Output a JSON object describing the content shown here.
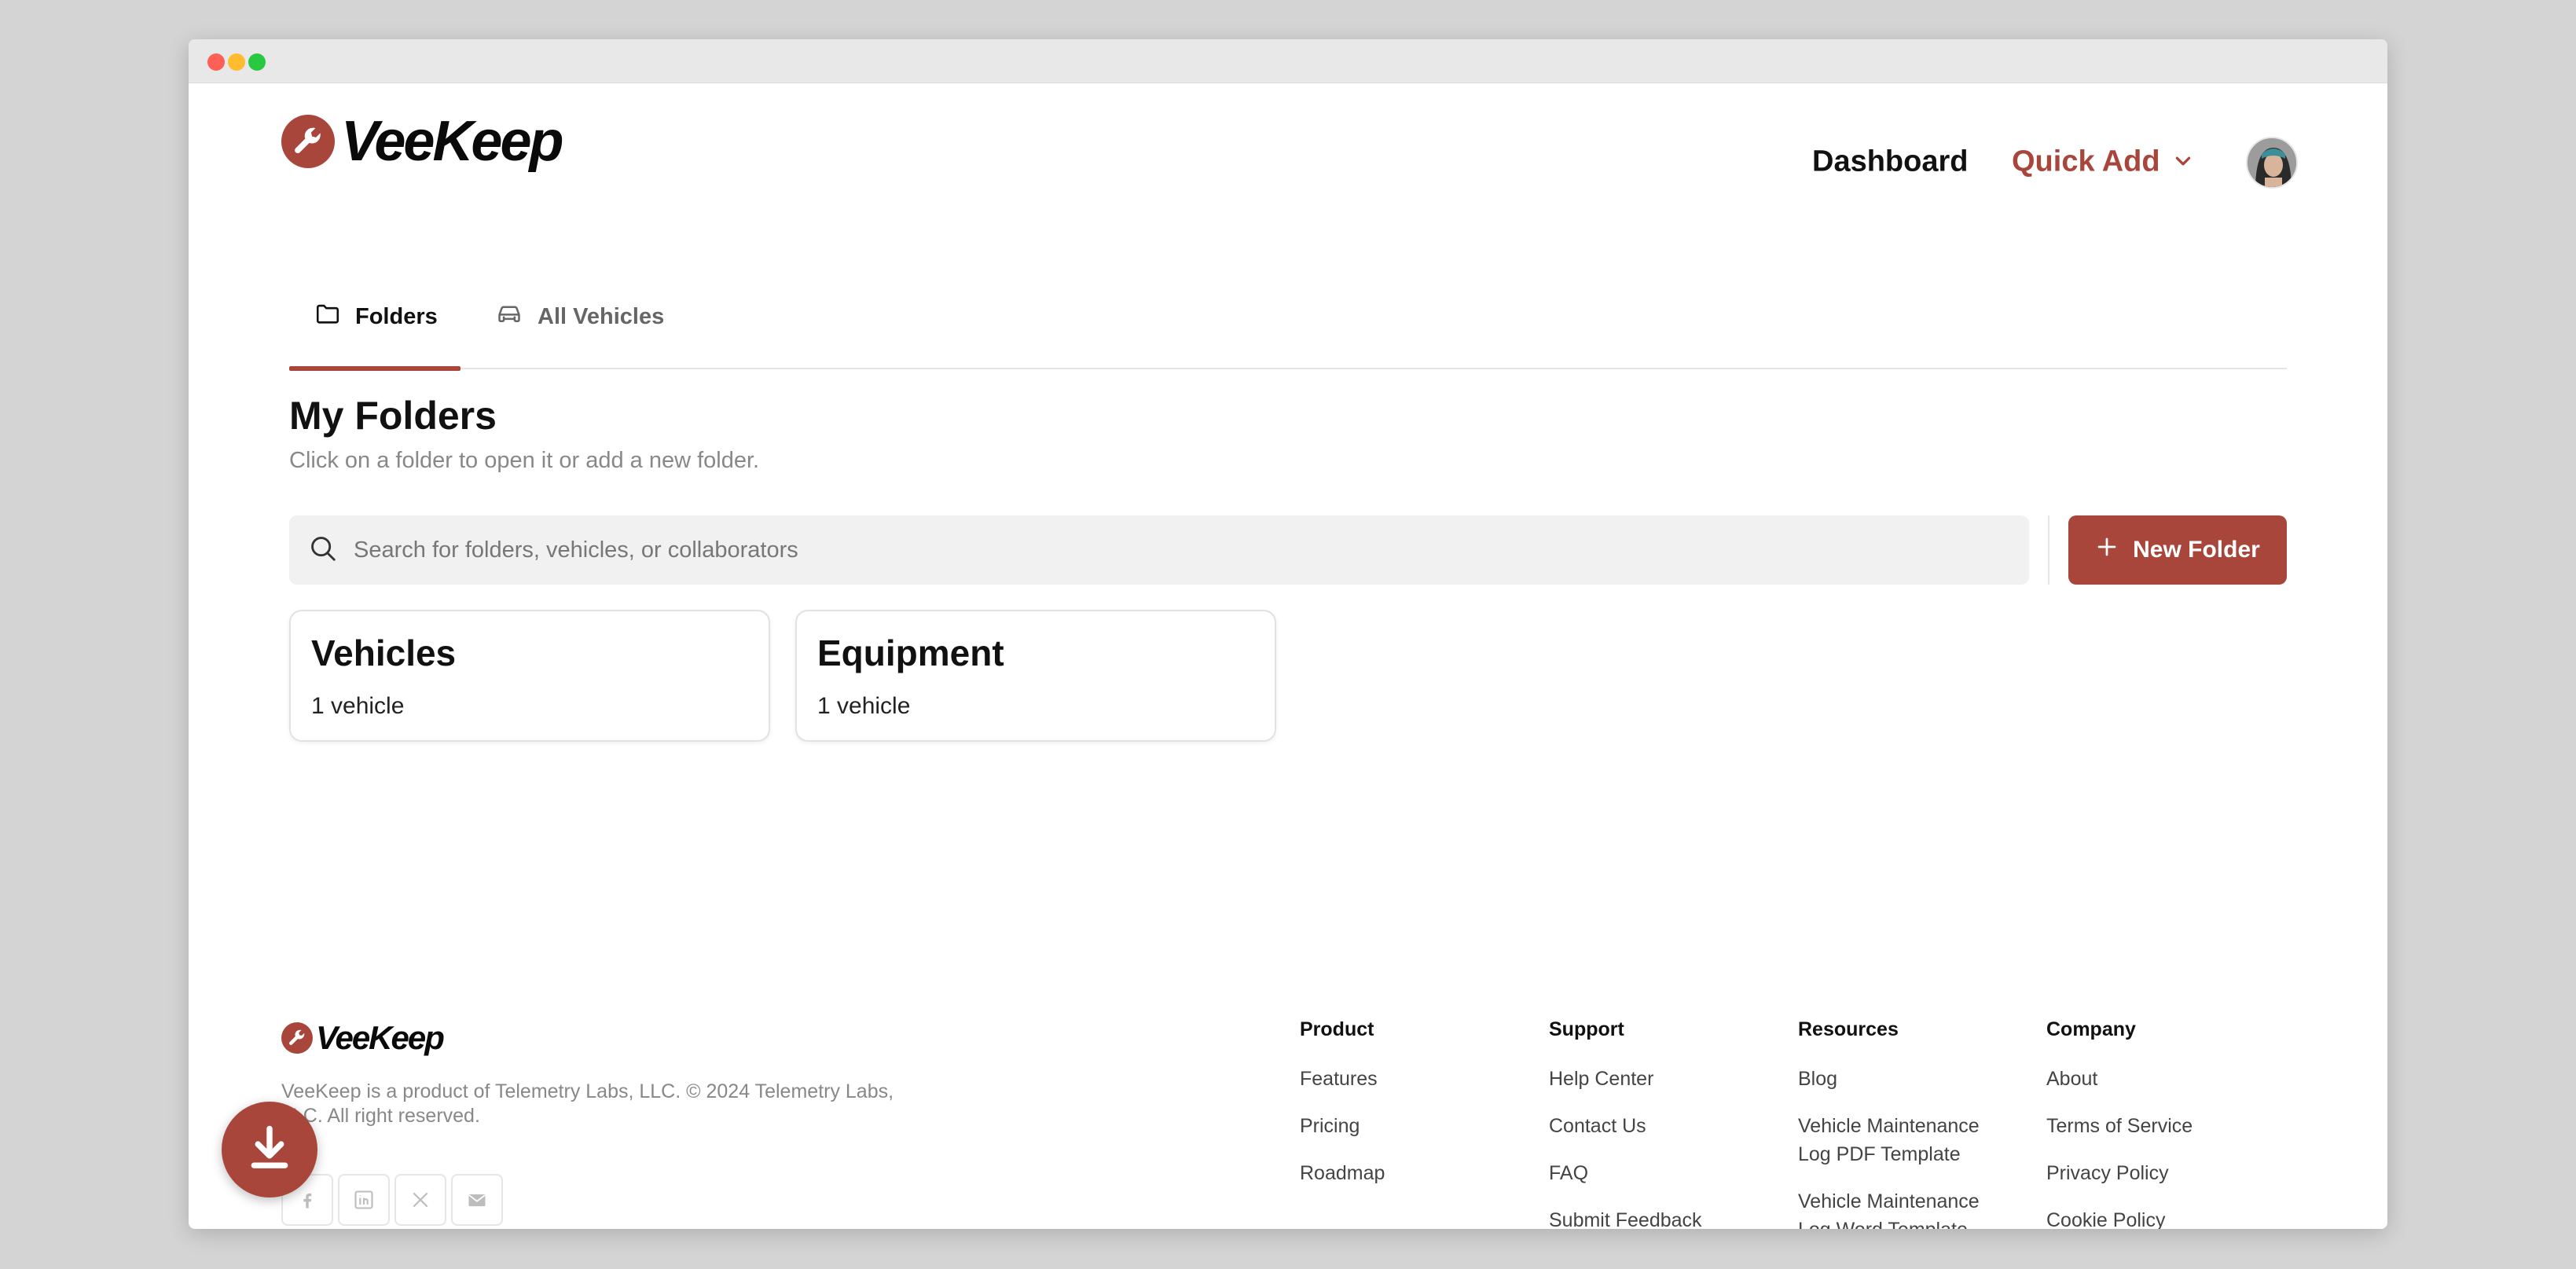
{
  "brand": {
    "name": "VeeKeep",
    "accent_color": "#a8463c"
  },
  "header": {
    "nav_dashboard": "Dashboard",
    "nav_quick_add": "Quick Add"
  },
  "tabs": [
    {
      "label": "Folders",
      "icon": "folder-icon",
      "active": true
    },
    {
      "label": "All Vehicles",
      "icon": "car-icon",
      "active": false
    }
  ],
  "main": {
    "title": "My Folders",
    "subtitle": "Click on a folder to open it or add a new folder.",
    "search_placeholder": "Search for folders, vehicles, or collaborators",
    "new_folder_label": "New Folder"
  },
  "folders": [
    {
      "name": "Vehicles",
      "count": "1 vehicle"
    },
    {
      "name": "Equipment",
      "count": "1 vehicle"
    }
  ],
  "footer": {
    "copyright": "VeeKeep is a product of Telemetry Labs, LLC. © 2024 Telemetry Labs, LLC. All right reserved.",
    "columns": [
      {
        "heading": "Product",
        "links": [
          "Features",
          "Pricing",
          "Roadmap"
        ]
      },
      {
        "heading": "Support",
        "links": [
          "Help Center",
          "Contact Us",
          "FAQ",
          "Submit Feedback"
        ]
      },
      {
        "heading": "Resources",
        "links": [
          "Blog",
          "Vehicle Maintenance Log PDF Template",
          "Vehicle Maintenance Log Word Template"
        ]
      },
      {
        "heading": "Company",
        "links": [
          "About",
          "Terms of Service",
          "Privacy Policy",
          "Cookie Policy"
        ]
      }
    ],
    "socials": [
      "facebook-icon",
      "linkedin-icon",
      "x-icon",
      "email-icon"
    ]
  }
}
